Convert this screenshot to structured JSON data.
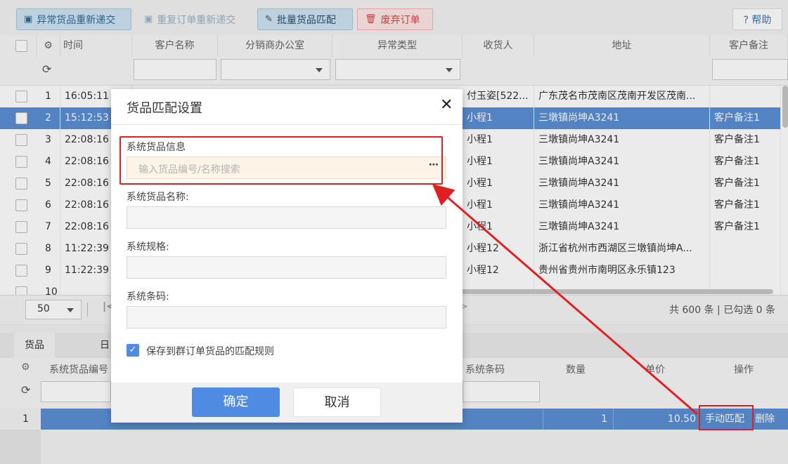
{
  "toolbar": {
    "resubmit_abnormal": "异常货品重新递交",
    "resubmit_duplicate": "重复订单重新递交",
    "batch_match": "批量货品匹配",
    "discard": "废弃订单",
    "help": "? 帮助"
  },
  "grid": {
    "columns": [
      "时间",
      "客户名称",
      "分销商办公室",
      "异常类型",
      "收货人",
      "地址",
      "客户备注"
    ],
    "rows": [
      {
        "no": "1",
        "time": "16:05:11",
        "receiver": "付玉姿[522...",
        "address": "广东茂名市茂南区茂南开发区茂南...",
        "remark": ""
      },
      {
        "no": "2",
        "time": "15:12:53",
        "receiver": "小程1",
        "address": "三墩镇尚坤A3241",
        "remark": "客户备注1"
      },
      {
        "no": "3",
        "time": "22:08:16",
        "receiver": "小程1",
        "address": "三墩镇尚坤A3241",
        "remark": "客户备注1"
      },
      {
        "no": "4",
        "time": "22:08:16",
        "receiver": "小程1",
        "address": "三墩镇尚坤A3241",
        "remark": "客户备注1"
      },
      {
        "no": "5",
        "time": "22:08:16",
        "receiver": "小程1",
        "address": "三墩镇尚坤A3241",
        "remark": "客户备注1"
      },
      {
        "no": "6",
        "time": "22:08:16",
        "receiver": "小程1",
        "address": "三墩镇尚坤A3241",
        "remark": "客户备注1"
      },
      {
        "no": "7",
        "time": "22:08:16",
        "receiver": "小程1",
        "address": "三墩镇尚坤A3241",
        "remark": "客户备注1"
      },
      {
        "no": "8",
        "time": "11:22:39",
        "receiver": "小程12",
        "address": "浙江省杭州市西湖区三墩镇尚坤A...",
        "remark": ""
      },
      {
        "no": "9",
        "time": "11:22:39",
        "receiver": "小程12",
        "address": "贵州省贵州市南明区永乐镇123",
        "remark": ""
      },
      {
        "no": "10",
        "time": "",
        "receiver": "",
        "address": "",
        "remark": ""
      }
    ]
  },
  "pager": {
    "page_size": "50",
    "summary": "共 600 条 | 已勾选 0 条"
  },
  "detail": {
    "tabs": [
      "货品",
      "日"
    ],
    "columns": [
      "系统货品编号",
      "系统条码",
      "数量",
      "单价",
      "操作"
    ],
    "row": {
      "no": "1",
      "qty": "1",
      "price": "10.50",
      "manual_match": "手动匹配",
      "delete": "删除"
    }
  },
  "modal": {
    "title": "货品匹配设置",
    "close": "✕",
    "field_info_label": "系统货品信息",
    "field_info_placeholder": "输入货品编号/名称搜索",
    "field_name_label": "系统货品名称:",
    "field_spec_label": "系统规格:",
    "field_barcode_label": "系统条码:",
    "save_rule_label": "保存到群订单货品的匹配规则",
    "ok": "确定",
    "cancel": "取消"
  },
  "colors": {
    "accent": "#4f8be3",
    "selected_row": "#5b8fd4",
    "highlight": "#e02020"
  }
}
